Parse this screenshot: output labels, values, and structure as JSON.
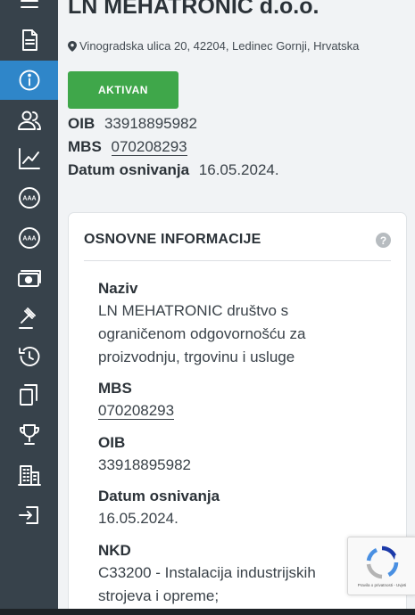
{
  "sidebar": {
    "items": [
      {
        "name": "menu",
        "icon": "hamburger-icon"
      },
      {
        "name": "document",
        "icon": "document-icon"
      },
      {
        "name": "info",
        "icon": "info-icon",
        "active": true
      },
      {
        "name": "people",
        "icon": "people-icon"
      },
      {
        "name": "chart",
        "icon": "line-chart-icon"
      },
      {
        "name": "rating-1",
        "icon": "aaa-rating-icon"
      },
      {
        "name": "rating-2",
        "icon": "aaa-rating-icon"
      },
      {
        "name": "money",
        "icon": "money-icon"
      },
      {
        "name": "legal",
        "icon": "gavel-icon"
      },
      {
        "name": "history",
        "icon": "history-icon"
      },
      {
        "name": "copies",
        "icon": "copy-icon"
      },
      {
        "name": "awards",
        "icon": "trophy-icon"
      },
      {
        "name": "companies",
        "icon": "building-icon"
      },
      {
        "name": "login",
        "icon": "sign-in-icon"
      }
    ]
  },
  "company": {
    "name": "LN MEHATRONIC d.o.o.",
    "address": "Vinogradska ulica 20, 42204, Ledinec Gornji, Hrvatska",
    "status": "AKTIVAN",
    "oib_label": "OIB",
    "oib": "33918895982",
    "mbs_label": "MBS",
    "mbs": "070208293",
    "founded_label": "Datum osnivanja",
    "founded": "16.05.2024."
  },
  "card": {
    "title": "OSNOVNE INFORMACIJE",
    "help": "?",
    "fields": {
      "naziv": {
        "label": "Naziv",
        "value": "LN MEHATRONIC društvo s ograničenom odgovornošću za proizvodnju, trgovinu i usluge"
      },
      "mbs": {
        "label": "MBS",
        "value": "070208293"
      },
      "oib": {
        "label": "OIB",
        "value": "33918895982"
      },
      "datum": {
        "label": "Datum osnivanja",
        "value": "16.05.2024."
      },
      "nkd": {
        "label": "NKD",
        "value": "C33200 - Instalacija industrijskih strojeva i opreme;"
      }
    }
  },
  "recaptcha": {
    "text": "Pravila o privatnosti - Uvjeti"
  },
  "colors": {
    "sidebar": "#37424b",
    "active": "#2f86c9",
    "status": "#3fa74a"
  }
}
